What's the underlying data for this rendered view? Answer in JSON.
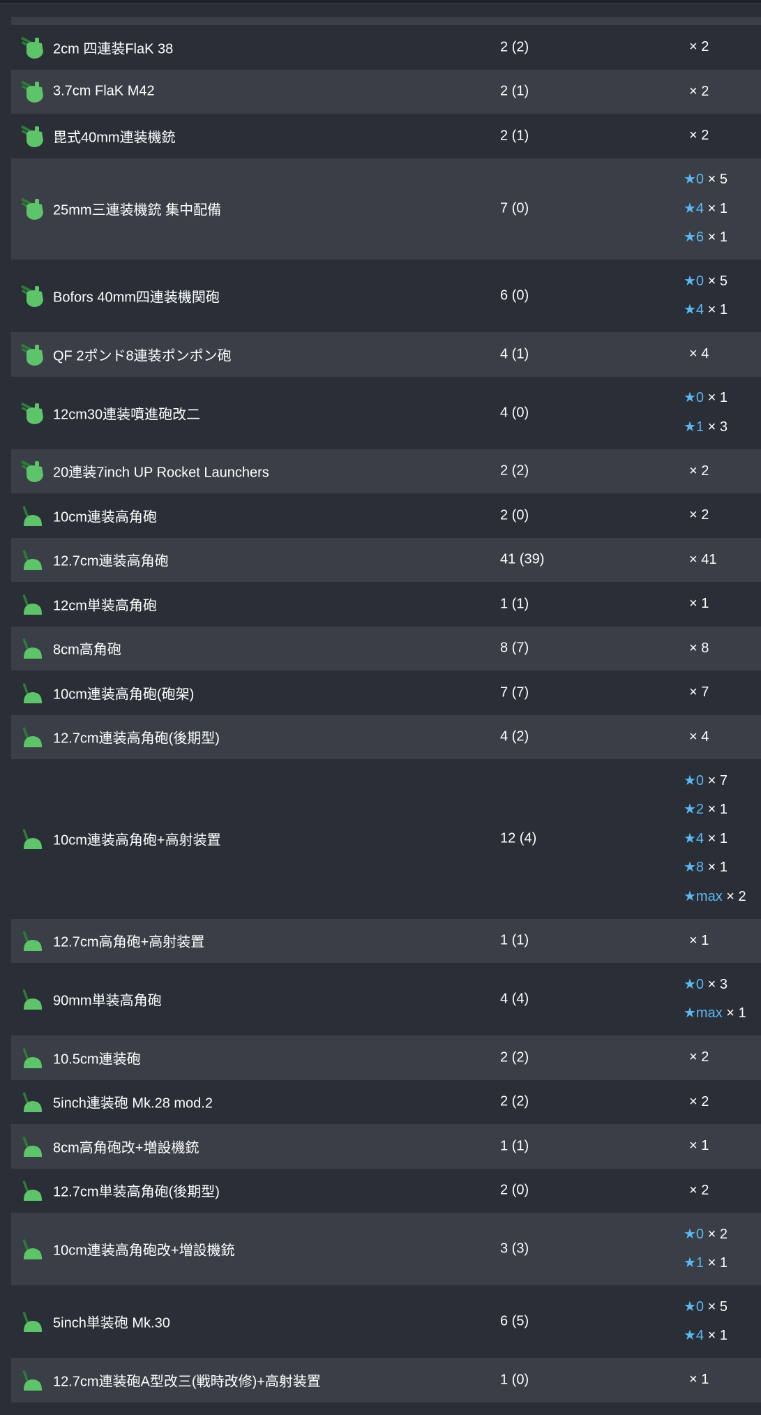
{
  "rows": [
    {
      "icon": "aa-gun-icon",
      "name": "2cm 四連装FlaK 38",
      "count": "2 (2)",
      "stars": [
        {
          "lv": "",
          "qty": "× 2"
        }
      ]
    },
    {
      "icon": "aa-gun-icon",
      "name": "3.7cm FlaK M42",
      "count": "2 (1)",
      "stars": [
        {
          "lv": "",
          "qty": "× 2"
        }
      ]
    },
    {
      "icon": "aa-gun-icon",
      "name": "毘式40mm連装機銃",
      "count": "2 (1)",
      "stars": [
        {
          "lv": "",
          "qty": "× 2"
        }
      ]
    },
    {
      "icon": "aa-gun-icon",
      "name": "25mm三連装機銃 集中配備",
      "count": "7 (0)",
      "stars": [
        {
          "lv": "★0",
          "qty": "× 5"
        },
        {
          "lv": "★4",
          "qty": "× 1"
        },
        {
          "lv": "★6",
          "qty": "× 1"
        }
      ]
    },
    {
      "icon": "aa-gun-icon",
      "name": "Bofors 40mm四連装機関砲",
      "count": "6 (0)",
      "stars": [
        {
          "lv": "★0",
          "qty": "× 5"
        },
        {
          "lv": "★4",
          "qty": "× 1"
        }
      ]
    },
    {
      "icon": "aa-gun-icon",
      "name": "QF 2ポンド8連装ポンポン砲",
      "count": "4 (1)",
      "stars": [
        {
          "lv": "",
          "qty": "× 4"
        }
      ]
    },
    {
      "icon": "aa-gun-icon",
      "name": "12cm30連装噴進砲改二",
      "count": "4 (0)",
      "stars": [
        {
          "lv": "★0",
          "qty": "× 1"
        },
        {
          "lv": "★1",
          "qty": "× 3"
        }
      ]
    },
    {
      "icon": "aa-gun-icon",
      "name": "20連装7inch UP Rocket Launchers",
      "count": "2 (2)",
      "stars": [
        {
          "lv": "",
          "qty": "× 2"
        }
      ]
    },
    {
      "icon": "ha-gun-icon",
      "name": "10cm連装高角砲",
      "count": "2 (0)",
      "stars": [
        {
          "lv": "",
          "qty": "× 2"
        }
      ]
    },
    {
      "icon": "ha-gun-icon",
      "name": "12.7cm連装高角砲",
      "count": "41 (39)",
      "stars": [
        {
          "lv": "",
          "qty": "× 41"
        }
      ]
    },
    {
      "icon": "ha-gun-icon",
      "name": "12cm単装高角砲",
      "count": "1 (1)",
      "stars": [
        {
          "lv": "",
          "qty": "× 1"
        }
      ]
    },
    {
      "icon": "ha-gun-icon",
      "name": "8cm高角砲",
      "count": "8 (7)",
      "stars": [
        {
          "lv": "",
          "qty": "× 8"
        }
      ]
    },
    {
      "icon": "ha-gun-icon",
      "name": "10cm連装高角砲(砲架)",
      "count": "7 (7)",
      "stars": [
        {
          "lv": "",
          "qty": "× 7"
        }
      ]
    },
    {
      "icon": "ha-gun-icon",
      "name": "12.7cm連装高角砲(後期型)",
      "count": "4 (2)",
      "stars": [
        {
          "lv": "",
          "qty": "× 4"
        }
      ]
    },
    {
      "icon": "ha-gun-icon",
      "name": "10cm連装高角砲+高射装置",
      "count": "12 (4)",
      "stars": [
        {
          "lv": "★0",
          "qty": "× 7"
        },
        {
          "lv": "★2",
          "qty": "× 1"
        },
        {
          "lv": "★4",
          "qty": "× 1"
        },
        {
          "lv": "★8",
          "qty": "× 1"
        },
        {
          "lv": "★max",
          "qty": "× 2"
        }
      ]
    },
    {
      "icon": "ha-gun-icon",
      "name": "12.7cm高角砲+高射装置",
      "count": "1 (1)",
      "stars": [
        {
          "lv": "",
          "qty": "× 1"
        }
      ]
    },
    {
      "icon": "ha-gun-icon",
      "name": "90mm単装高角砲",
      "count": "4 (4)",
      "stars": [
        {
          "lv": "★0",
          "qty": "× 3"
        },
        {
          "lv": "★max",
          "qty": "× 1"
        }
      ]
    },
    {
      "icon": "ha-gun-icon",
      "name": "10.5cm連装砲",
      "count": "2 (2)",
      "stars": [
        {
          "lv": "",
          "qty": "× 2"
        }
      ]
    },
    {
      "icon": "ha-gun-icon",
      "name": "5inch連装砲 Mk.28 mod.2",
      "count": "2 (2)",
      "stars": [
        {
          "lv": "",
          "qty": "× 2"
        }
      ]
    },
    {
      "icon": "ha-gun-icon",
      "name": "8cm高角砲改+増設機銃",
      "count": "1 (1)",
      "stars": [
        {
          "lv": "",
          "qty": "× 1"
        }
      ]
    },
    {
      "icon": "ha-gun-icon",
      "name": "12.7cm単装高角砲(後期型)",
      "count": "2 (0)",
      "stars": [
        {
          "lv": "",
          "qty": "× 2"
        }
      ]
    },
    {
      "icon": "ha-gun-icon",
      "name": "10cm連装高角砲改+増設機銃",
      "count": "3 (3)",
      "stars": [
        {
          "lv": "★0",
          "qty": "× 2"
        },
        {
          "lv": "★1",
          "qty": "× 1"
        }
      ]
    },
    {
      "icon": "ha-gun-icon",
      "name": "5inch単装砲 Mk.30",
      "count": "6 (5)",
      "stars": [
        {
          "lv": "★0",
          "qty": "× 5"
        },
        {
          "lv": "★4",
          "qty": "× 1"
        }
      ]
    },
    {
      "icon": "ha-gun-icon",
      "name": "12.7cm連装砲A型改三(戦時改修)+高射装置",
      "count": "1 (0)",
      "stars": [
        {
          "lv": "",
          "qty": "× 1"
        }
      ]
    }
  ],
  "colors": {
    "icon_green": "#5ec46a",
    "icon_dark": "#2f7a3a",
    "star_blue": "#5cb8f0"
  }
}
